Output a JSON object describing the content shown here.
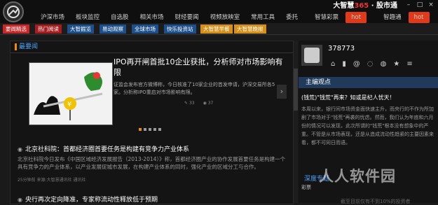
{
  "app": {
    "brand": "大智慧",
    "brand_num": "365",
    "brand_suffix": "· 股市通",
    "colors": {
      "accent": "#f08a00",
      "link": "#4aa3ff",
      "hot": "#e03a1a",
      "active_tab": "#c8282a"
    }
  },
  "top_nav": {
    "row1": [
      "沪深市场",
      "板块监控",
      "自选股",
      "相关市场",
      "财经要闻",
      "视频放映室",
      "常用工具",
      "委托",
      "智慧彩票",
      "智趣通"
    ],
    "hot_label": "hot"
  },
  "tabs": [
    "要闻精选",
    "热门阅读",
    "大智掘览",
    "易动观察",
    "全球市场",
    "快乐投资站",
    "大智慧早餐",
    "大智慧晚报"
  ],
  "main": {
    "section_title": "最要闻",
    "feature_title": "IPO再开闸首批10企业获批，分析师对市场影响有限",
    "feature_text": "证监会发布官方微博称，今日核准了10家企业的首发申请，沪深交易所各5家。分析称IPO重启对市场影响有限。",
    "feature_meta": [
      "33",
      "37"
    ],
    "news1_title": "北京社科院：首都经济圈首要任务是构建有竞争力产业体系",
    "news1_text": "北京社科院今日发布《中国区域经济发展报告（2013-2014）》称，首都经济圈产业的协作发展首要任务是构建一个具有竞争力的产业体系，以产业发展促城市发展，在构建产业体系的同时，强化产业的区域分工与合作。",
    "news1_meta": "25分钟前  来源:大智慧通讯社 通讯社",
    "news2_title": "央行再次定向降准，专家称流动性释放低于预期"
  },
  "side": {
    "username": "378773",
    "section_title": "主编观点",
    "article_title": "(钱荒)\"钱荒\"再来？知或是杞人忧天！",
    "article_text": "本周以来，银行间市场资金面快速主升，而央行的不作为所加剧了市场对于\"钱荒\"再袭的忧虑。然而，我们认为年底和六月份的情况可以发现，此次所谓的\"钱荒\"根本没有想象中的严重。不管是从市场表现，还是从造成流动性趋紧的主要因素来看，都不可同日而语。",
    "section2": "深度专题",
    "bottom1": "彩票",
    "bottom2": "截至目前仅有不到10%的投资者",
    "watermark": "人人软件园"
  }
}
